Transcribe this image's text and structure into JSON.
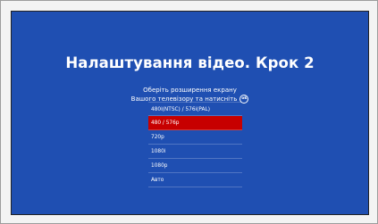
{
  "screen": {
    "title": "Налаштування відео. Крок 2",
    "subtitle_line1": "Оберіть розширення екрану",
    "subtitle_line2": "Вашого телевізору та натисніть",
    "ok_label": "ok"
  },
  "options": [
    {
      "label": "480i(NTSC) / 576i(PAL)"
    },
    {
      "label": "480 / 576p"
    },
    {
      "label": "720p"
    },
    {
      "label": "1080i"
    },
    {
      "label": "1080p"
    },
    {
      "label": "Авто"
    }
  ],
  "selected_option_index": 1,
  "colors": {
    "background": "#1f4fb2",
    "selected": "#c70000",
    "text": "#ffffff"
  }
}
